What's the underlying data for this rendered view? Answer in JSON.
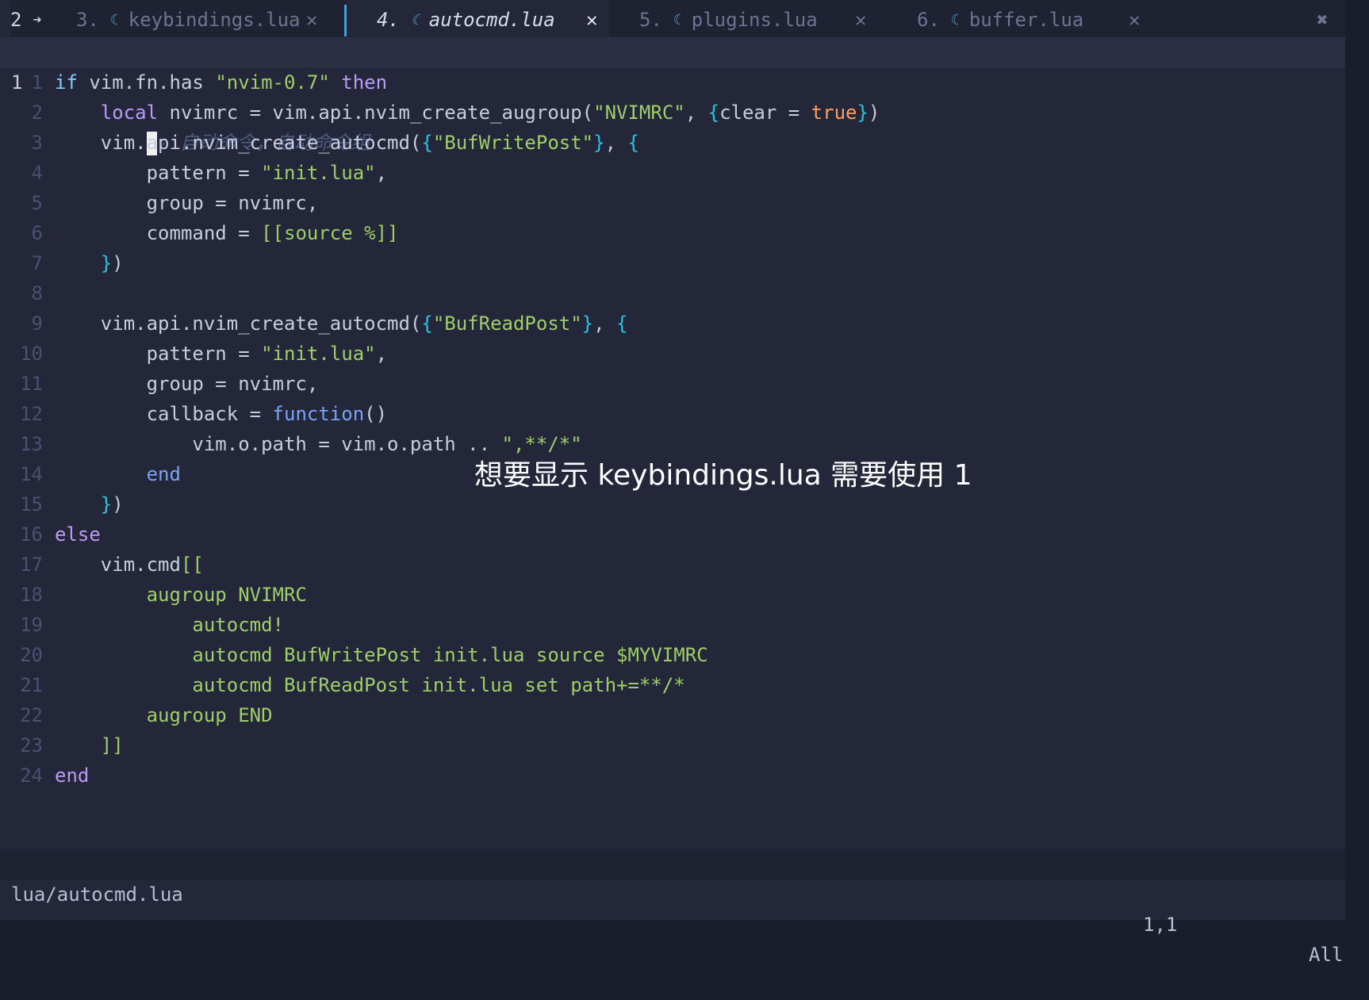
{
  "tabline": {
    "tab_count": "2",
    "tab_count_icon": "circle-arrow-icon",
    "tabs": [
      {
        "index": "3.",
        "name": "keybindings.lua",
        "close": "✕",
        "active": false
      },
      {
        "index": "4.",
        "name": "autocmd.lua",
        "close": "✕",
        "active": true
      },
      {
        "index": "5.",
        "name": "plugins.lua",
        "close": "✕",
        "active": false
      },
      {
        "index": "6.",
        "name": "buffer.lua",
        "close": "✕",
        "active": false
      }
    ],
    "file_icon": "moon-icon",
    "close_all": "✖"
  },
  "editor": {
    "current_line_number": "1",
    "comment_text": "- 自动命令，自动命令组",
    "lines": [
      [
        {
          "t": "kw2",
          "v": "if "
        },
        {
          "t": "plain",
          "v": "vim.fn.has "
        },
        {
          "t": "str",
          "v": "\"nvim-0.7\""
        },
        {
          "t": "plain",
          "v": " "
        },
        {
          "t": "kw",
          "v": "then"
        }
      ],
      [
        {
          "t": "plain",
          "v": "    "
        },
        {
          "t": "kw",
          "v": "local"
        },
        {
          "t": "plain",
          "v": " nvimrc = vim.api.nvim_create_augroup("
        },
        {
          "t": "str",
          "v": "\"NVIMRC\""
        },
        {
          "t": "plain",
          "v": ", "
        },
        {
          "t": "br",
          "v": "{"
        },
        {
          "t": "plain",
          "v": "clear = "
        },
        {
          "t": "bool",
          "v": "true"
        },
        {
          "t": "br",
          "v": "}"
        },
        {
          "t": "plain",
          "v": ")"
        }
      ],
      [
        {
          "t": "plain",
          "v": "    vim.api.nvim_create_autocmd("
        },
        {
          "t": "br",
          "v": "{"
        },
        {
          "t": "str",
          "v": "\"BufWritePost\""
        },
        {
          "t": "br",
          "v": "}"
        },
        {
          "t": "plain",
          "v": ", "
        },
        {
          "t": "br",
          "v": "{"
        }
      ],
      [
        {
          "t": "plain",
          "v": "        pattern = "
        },
        {
          "t": "str",
          "v": "\"init.lua\""
        },
        {
          "t": "plain",
          "v": ","
        }
      ],
      [
        {
          "t": "plain",
          "v": "        group = nvimrc,"
        }
      ],
      [
        {
          "t": "plain",
          "v": "        command = "
        },
        {
          "t": "str",
          "v": "[[source %]]"
        }
      ],
      [
        {
          "t": "plain",
          "v": "    "
        },
        {
          "t": "br",
          "v": "}"
        },
        {
          "t": "plain",
          "v": ")"
        }
      ],
      [],
      [
        {
          "t": "plain",
          "v": "    vim.api.nvim_create_autocmd("
        },
        {
          "t": "br",
          "v": "{"
        },
        {
          "t": "str",
          "v": "\"BufReadPost\""
        },
        {
          "t": "br",
          "v": "}"
        },
        {
          "t": "plain",
          "v": ", "
        },
        {
          "t": "br",
          "v": "{"
        }
      ],
      [
        {
          "t": "plain",
          "v": "        pattern = "
        },
        {
          "t": "str",
          "v": "\"init.lua\""
        },
        {
          "t": "plain",
          "v": ","
        }
      ],
      [
        {
          "t": "plain",
          "v": "        group = nvimrc,"
        }
      ],
      [
        {
          "t": "plain",
          "v": "        callback = "
        },
        {
          "t": "fn",
          "v": "function"
        },
        {
          "t": "plain",
          "v": "()"
        }
      ],
      [
        {
          "t": "plain",
          "v": "            vim.o.path = vim.o.path .. "
        },
        {
          "t": "str",
          "v": "\",**/*\""
        }
      ],
      [
        {
          "t": "plain",
          "v": "        "
        },
        {
          "t": "fn",
          "v": "end"
        }
      ],
      [
        {
          "t": "plain",
          "v": "    "
        },
        {
          "t": "br",
          "v": "}"
        },
        {
          "t": "plain",
          "v": ")"
        }
      ],
      [
        {
          "t": "kw",
          "v": "else"
        }
      ],
      [
        {
          "t": "plain",
          "v": "    vim.cmd"
        },
        {
          "t": "str",
          "v": "[["
        }
      ],
      [
        {
          "t": "str",
          "v": "        augroup NVIMRC"
        }
      ],
      [
        {
          "t": "str",
          "v": "            autocmd!"
        }
      ],
      [
        {
          "t": "str",
          "v": "            autocmd BufWritePost init.lua source $MYVIMRC"
        }
      ],
      [
        {
          "t": "str",
          "v": "            autocmd BufReadPost init.lua set path+=**/*"
        }
      ],
      [
        {
          "t": "str",
          "v": "        augroup END"
        }
      ],
      [
        {
          "t": "str",
          "v": "    ]]"
        }
      ],
      [
        {
          "t": "kw",
          "v": "end"
        }
      ]
    ]
  },
  "overlay_text": "想要显示 keybindings.lua 需要使用 1",
  "statusline": {
    "file": "lua/autocmd.lua",
    "position": "1,1",
    "percent": "All"
  },
  "colors": {
    "background": "#232739",
    "tabline_bg": "#1e2231",
    "accent": "#4a9cd6",
    "string": "#9ece6a",
    "keyword": "#bb9af7",
    "function": "#7aa2f7",
    "boolean": "#ff9e64"
  }
}
